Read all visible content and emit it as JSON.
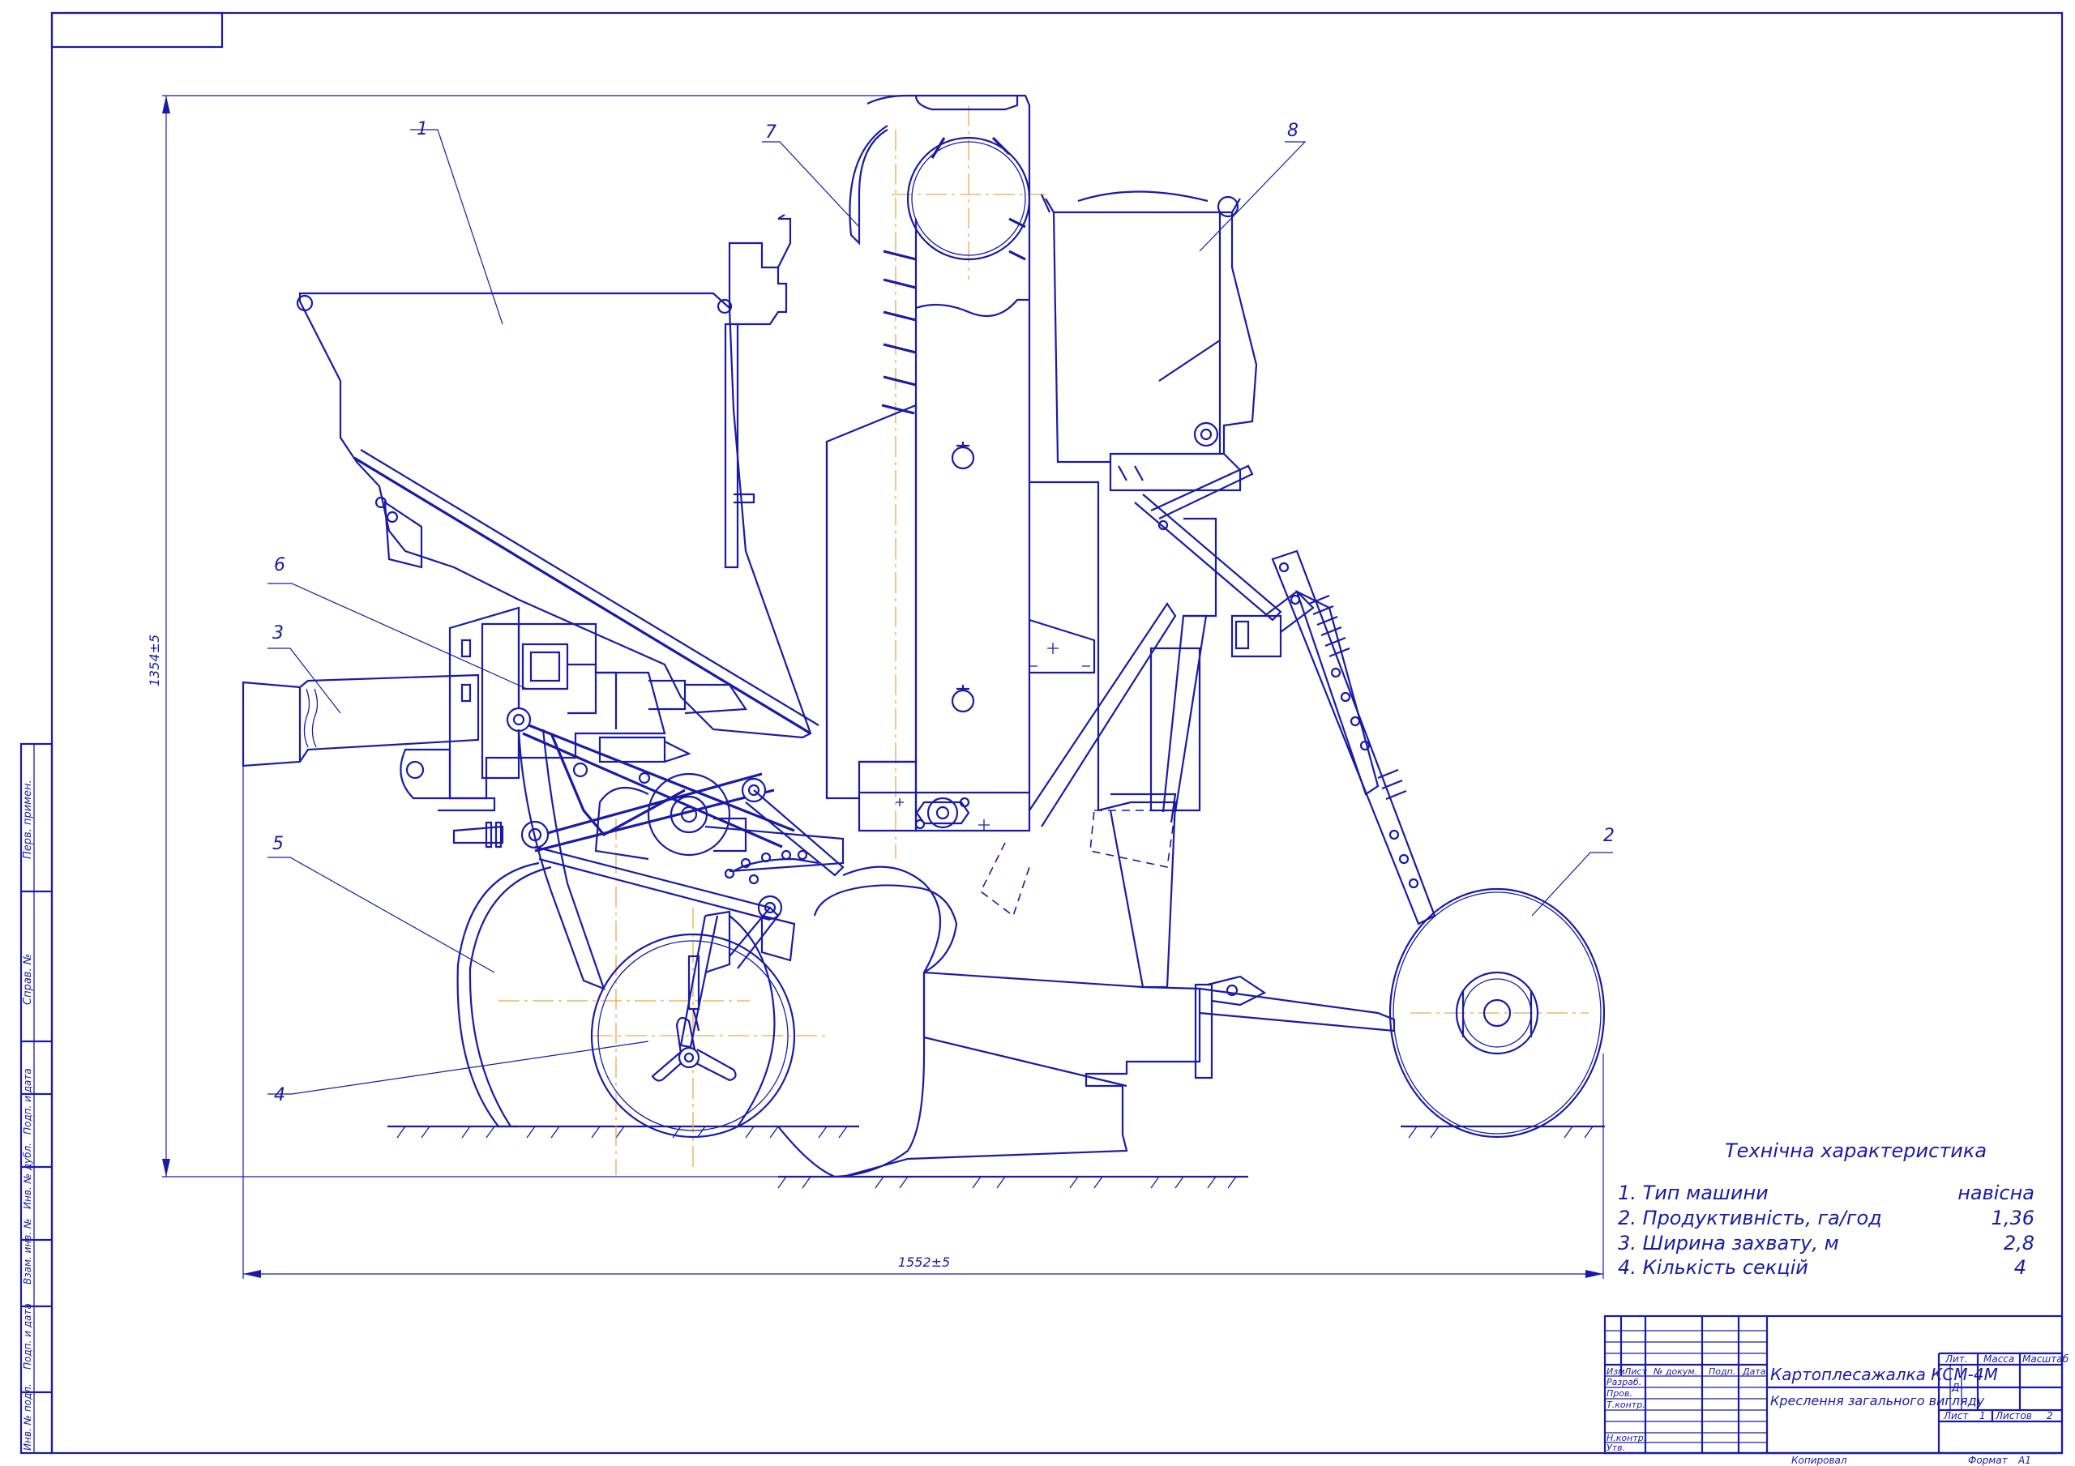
{
  "drawing": {
    "title": "Картоплесажалка КСМ-4М",
    "subtitle": "Креслення загального вигляду",
    "dimension_height": "1354±5",
    "dimension_width": "1552±5",
    "part_labels": [
      "1",
      "2",
      "3",
      "4",
      "5",
      "6",
      "7",
      "8"
    ]
  },
  "specs": {
    "heading": "Технічна характеристика",
    "rows": [
      {
        "label": "1. Тип машини",
        "value": "навісна"
      },
      {
        "label": "2. Продуктивність, га/год",
        "value": "1,36"
      },
      {
        "label": "3. Ширина захвату, м",
        "value": "2,8"
      },
      {
        "label": "4. Кількість секцій",
        "value": "4"
      }
    ]
  },
  "title_block": {
    "col_izm": "Изм",
    "col_list": "Лист",
    "col_doc": "№ докум.",
    "col_sign": "Подп.",
    "col_date": "Дата",
    "row_razrab": "Разраб.",
    "row_prov": "Пров.",
    "row_tkontr": "Т.контр.",
    "row_nkontr": "Н.контр.",
    "row_utv": "Утв.",
    "lit": "Лит.",
    "lit_value": "Д",
    "massa": "Масса",
    "masshtab": "Масштаб",
    "sheet_label": "Лист",
    "sheet_value": "1",
    "sheets_label": "Листов",
    "sheets_value": "2",
    "copied": "Копировал",
    "format_label": "Формат",
    "format_value": "А1"
  },
  "side_stamp": [
    "Перв. примен.",
    "Справ. №",
    "Подп. и дата",
    "Инв. № дубл.",
    "Взам. инв. №",
    "Подп. и дата",
    "Инв. № подл."
  ],
  "colors": {
    "line": "#1a1aa6",
    "centerline": "#e8a948",
    "paper": "#ffffff"
  }
}
